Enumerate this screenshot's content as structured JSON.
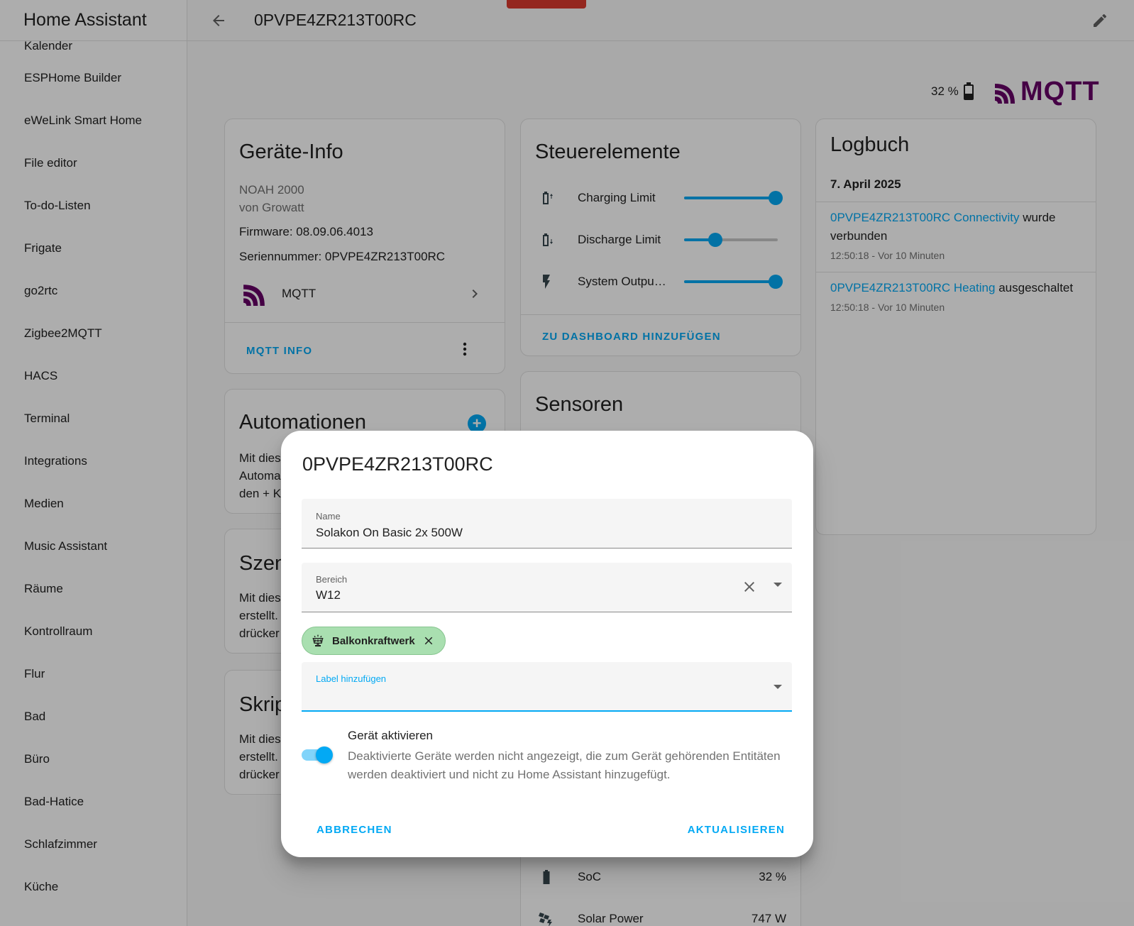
{
  "sidebar": {
    "title": "Home Assistant",
    "items": [
      {
        "label": "Kalender"
      },
      {
        "label": "ESPHome Builder"
      },
      {
        "label": "eWeLink Smart Home"
      },
      {
        "label": "File editor"
      },
      {
        "label": "To-do-Listen"
      },
      {
        "label": "Frigate"
      },
      {
        "label": "go2rtc"
      },
      {
        "label": "Zigbee2MQTT"
      },
      {
        "label": "HACS"
      },
      {
        "label": "Terminal"
      },
      {
        "label": "Integrations"
      },
      {
        "label": "Medien"
      },
      {
        "label": "Music Assistant"
      },
      {
        "label": "Räume"
      },
      {
        "label": "Kontrollraum"
      },
      {
        "label": "Flur"
      },
      {
        "label": "Bad"
      },
      {
        "label": "Büro"
      },
      {
        "label": "Bad-Hatice"
      },
      {
        "label": "Schlafzimmer"
      },
      {
        "label": "Küche"
      }
    ]
  },
  "topbar": {
    "title": "0PVPE4ZR213T00RC",
    "back_icon": "arrow-left-icon",
    "edit_icon": "pencil-icon"
  },
  "header": {
    "battery_text": "32 %",
    "mqtt_logo_text": "MQTT"
  },
  "device_info": {
    "title": "Geräte-Info",
    "model": "NOAH 2000",
    "manufacturer": "von Growatt",
    "firmware": "Firmware: 08.09.06.4013",
    "serial": "Seriennummer: 0PVPE4ZR213T00RC",
    "integration_label": "MQTT",
    "action_label": "MQTT INFO"
  },
  "automations": {
    "title": "Automationen",
    "desc_lines": [
      "Mit dies",
      "Automa",
      "den + K"
    ]
  },
  "scenes": {
    "title": "Szen",
    "desc_lines": [
      "Mit dies",
      "erstellt.",
      "drücker"
    ]
  },
  "scripts": {
    "title": "Skrip",
    "desc_lines": [
      "Mit dies",
      "erstellt.",
      "drücker"
    ]
  },
  "controls": {
    "title": "Steuerelemente",
    "items": [
      {
        "label": "Charging Limit",
        "icon": "battery-charging-up-icon",
        "value": 0.98
      },
      {
        "label": "Discharge Limit",
        "icon": "battery-arrow-down-icon",
        "value": 0.33
      },
      {
        "label": "System Output Power",
        "icon": "flash-icon",
        "value": 0.98
      }
    ],
    "action_label": "ZU DASHBOARD HINZUFÜGEN"
  },
  "sensors": {
    "title": "Sensoren",
    "items": [
      {
        "label": "SoC",
        "value": "32 %",
        "icon": "battery-icon"
      },
      {
        "label": "Solar Power",
        "value": "747 W",
        "icon": "solar-power-icon"
      }
    ]
  },
  "logbook": {
    "title": "Logbuch",
    "date": "7. April 2025",
    "entries": [
      {
        "link": "0PVPE4ZR213T00RC Connectivity",
        "text": "wurde verbunden",
        "time": "12:50:18 - Vor 10 Minuten"
      },
      {
        "link": "0PVPE4ZR213T00RC Heating",
        "text": "ausgeschaltet",
        "time": "12:50:18 - Vor 10 Minuten"
      }
    ]
  },
  "dialog": {
    "title": "0PVPE4ZR213T00RC",
    "name_label": "Name",
    "name_value": "Solakon On Basic 2x 500W",
    "area_label": "Bereich",
    "area_value": "W12",
    "chip_label": "Balkonkraftwerk",
    "labels_placeholder": "Label hinzufügen",
    "toggle_title": "Gerät aktivieren",
    "toggle_desc": "Deaktivierte Geräte werden nicht angezeigt, die zum Gerät gehörenden Entitäten werden deaktiviert und nicht zu Home Assistant hinzugefügt.",
    "toggle_on": true,
    "cancel_label": "ABBRECHEN",
    "update_label": "AKTUALISIEREN"
  },
  "colors": {
    "accent": "#03a9f4",
    "mqtt_brand": "#660066",
    "chip_bg": "#a9dfb0",
    "alert_tab": "#db3a2e"
  }
}
